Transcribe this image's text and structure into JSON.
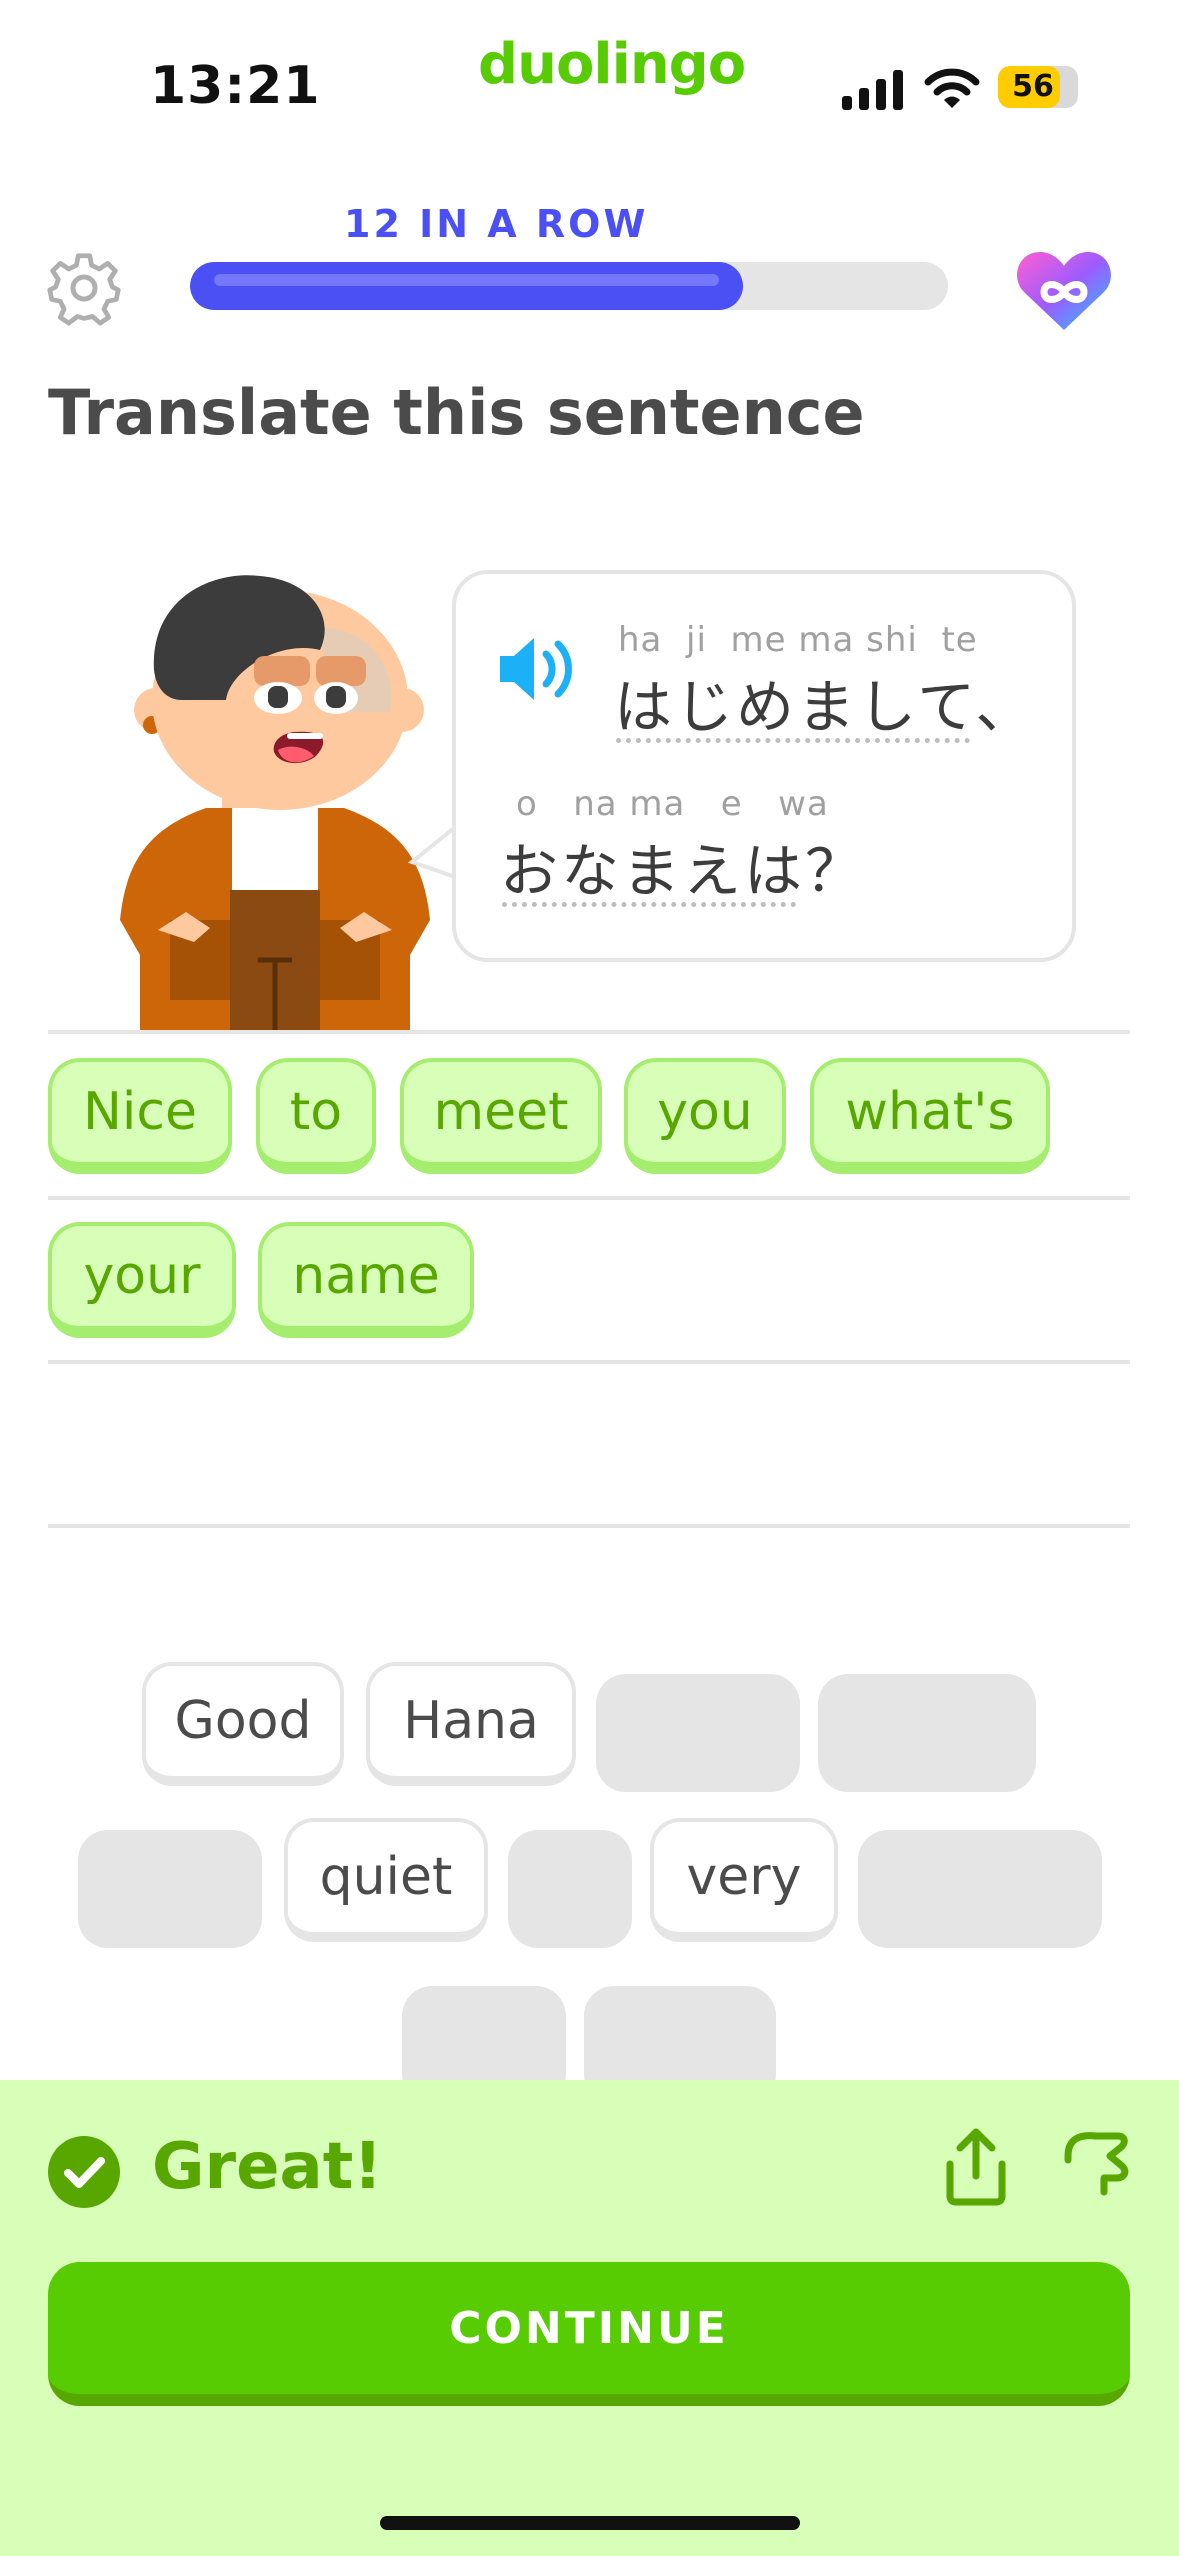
{
  "status_bar": {
    "time": "13:21",
    "battery": "56"
  },
  "brand": "duolingo",
  "progress": {
    "streak_label": "12 IN A ROW",
    "fraction": 0.73
  },
  "instruction": "Translate this sentence",
  "prompt": {
    "line1": {
      "romaji": "ha  ji  me ma shi  te",
      "japanese": "はじめまして、"
    },
    "line2": {
      "romaji": "o   na ma   e   wa",
      "japanese": "おなまえは？"
    }
  },
  "answer_words": [
    "Nice",
    "to",
    "meet",
    "you",
    "what's",
    "your",
    "name"
  ],
  "word_bank": [
    "Good",
    "Hana",
    "quiet",
    "very"
  ],
  "feedback": {
    "message": "Great!",
    "continue_label": "CONTINUE"
  },
  "colors": {
    "correct_green": "#58cc02",
    "dark_green": "#58a700",
    "panel_bg": "#d7ffb8",
    "streak_blue": "#4a50f3"
  },
  "icons": [
    "settings-gear-icon",
    "infinite-hearts-icon",
    "speaker-icon",
    "check-circle-icon",
    "share-icon",
    "report-flag-icon"
  ]
}
